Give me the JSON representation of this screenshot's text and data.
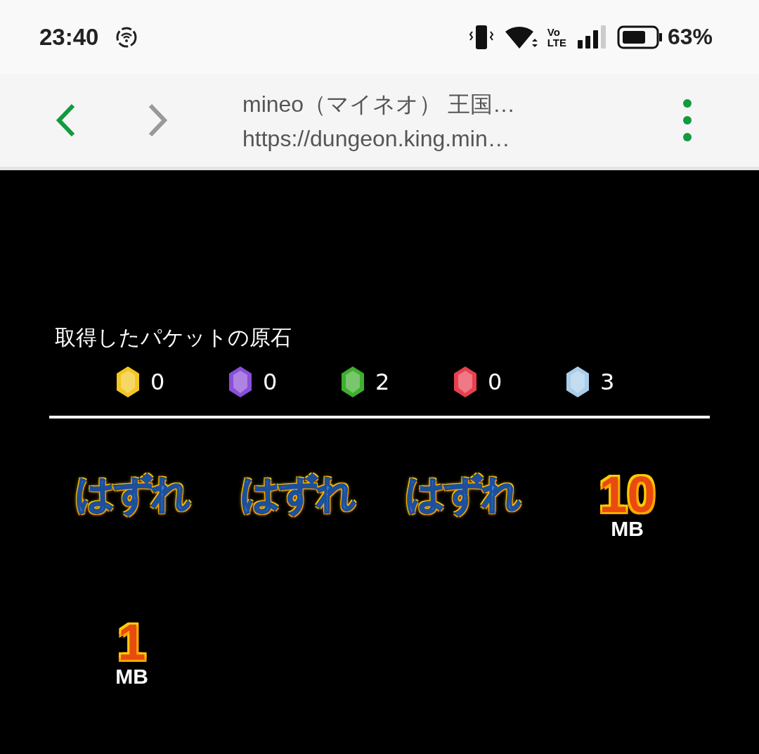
{
  "status_bar": {
    "time": "23:40",
    "battery_percent": "63%",
    "volte": {
      "top": "Vo",
      "bottom": "LTE"
    }
  },
  "browser_toolbar": {
    "back_enabled": true,
    "forward_enabled": false,
    "page_title": "mineo（マイネオ） 王国…",
    "url": "https://dungeon.king.min…"
  },
  "gems": {
    "title": "取得したパケットの原石",
    "items": [
      {
        "color": "#f2c623",
        "count": "0"
      },
      {
        "color": "#8a4fd8",
        "count": "0"
      },
      {
        "color": "#3fae2e",
        "count": "2"
      },
      {
        "color": "#e8404f",
        "count": "0"
      },
      {
        "color": "#a9cdea",
        "count": "3"
      }
    ]
  },
  "results": [
    {
      "kind": "miss",
      "text": "はずれ"
    },
    {
      "kind": "miss",
      "text": "はずれ"
    },
    {
      "kind": "miss",
      "text": "はずれ"
    },
    {
      "kind": "prize",
      "text": "10",
      "unit": "MB"
    },
    {
      "kind": "prize",
      "text": "1",
      "unit": "MB"
    }
  ]
}
